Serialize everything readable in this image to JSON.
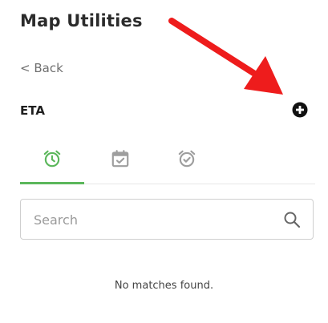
{
  "panel": {
    "title": "Map Utilities",
    "back_label": "< Back",
    "section_title": "ETA"
  },
  "tabs": [
    {
      "icon": "alarm-clock-icon",
      "active": true
    },
    {
      "icon": "calendar-check-icon",
      "active": false
    },
    {
      "icon": "alarm-check-icon",
      "active": false
    }
  ],
  "search": {
    "placeholder": "Search",
    "value": ""
  },
  "results": {
    "empty_message": "No matches found."
  },
  "colors": {
    "accent_green": "#5bb75b",
    "inactive_icon": "#9e9e9e",
    "annotation_arrow": "#ee1c1c"
  }
}
